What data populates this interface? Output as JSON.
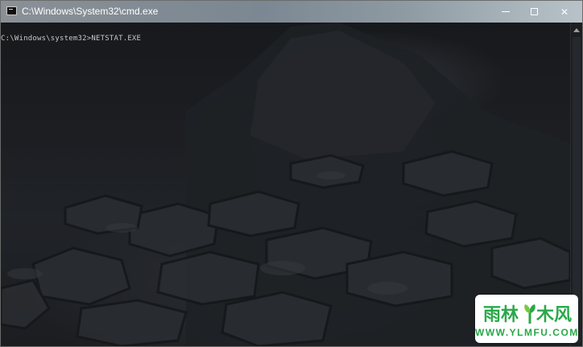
{
  "window": {
    "title": "C:\\Windows\\System32\\cmd.exe",
    "icon": "console-icon",
    "controls": {
      "minimize": "minimize-icon",
      "maximize": "maximize-icon",
      "close_glyph": "✕"
    }
  },
  "console": {
    "prompt": "C:\\Windows\\system32>NETSTAT.EXE",
    "text_color": "#c8c8c8"
  },
  "watermark": {
    "logo_text": "雨林木风",
    "url": "WWW.YLMFU.COM",
    "accent_color": "#2aa84a"
  }
}
